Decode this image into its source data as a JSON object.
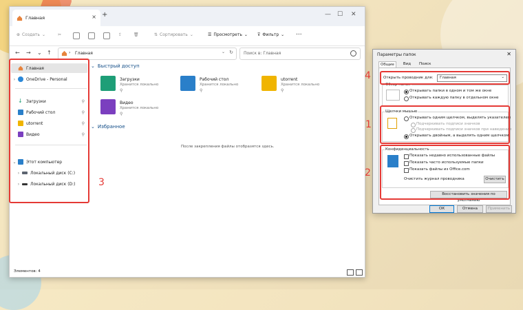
{
  "explorer": {
    "tab_title": "Главная",
    "toolbar": {
      "create": "Создать",
      "sort": "Сортировать",
      "view": "Просмотреть",
      "filter": "Фильтр",
      "more": "..."
    },
    "address": "Главная",
    "search_placeholder": "Поиск в: Главная",
    "nav": {
      "home": "Главная",
      "onedrive": "OneDrive - Personal",
      "downloads": "Загрузки",
      "desktop": "Рабочий стол",
      "utorrent": "utorrent",
      "video": "Видео",
      "this_pc": "Этот компьютер",
      "disk_c": "Локальный диск (C:)",
      "disk_d": "Локальный диск (D:)"
    },
    "quick_access_title": "Быстрый доступ",
    "quick_access": [
      {
        "name": "Загрузки",
        "sub": "Хранится локально"
      },
      {
        "name": "Рабочий стол",
        "sub": "Хранится локально"
      },
      {
        "name": "utorrent",
        "sub": "Хранится локально"
      },
      {
        "name": "Видео",
        "sub": "Хранится локально"
      }
    ],
    "favorites_title": "Избранное",
    "favorites_empty": "После закрепления файлы отобразятся здесь.",
    "status": "Элементов: 4"
  },
  "dialog": {
    "title": "Параметры папок",
    "tabs": [
      "Общие",
      "Вид",
      "Поиск"
    ],
    "open_explorer_label": "Открыть проводник для:",
    "open_explorer_value": "Главная",
    "browse_title": "Обзор папок",
    "browse_same": "Открывать папки в одном и том же окне",
    "browse_new": "Открывать каждую папку в отдельном окне",
    "click_title": "Щелчки мышью",
    "single_click": "Открывать одним щелчком, выделять указателем",
    "underline_always": "Подчеркивать подписи значков",
    "underline_hover": "Подчеркивать подписи значков при наведении",
    "double_click": "Открывать двойным, а выделять одним щелчком",
    "privacy_title": "Конфиденциальность",
    "show_recent": "Показать недавно использованные файлы",
    "show_frequent": "Показать часто используемые папки",
    "show_office": "Показать файлы из Office.com",
    "clear_history": "Очистить журнал проводника",
    "clear_btn": "Очистить",
    "restore_btn": "Восстановить значения по умолчанию",
    "ok": "ОК",
    "cancel": "Отмена",
    "apply": "Применить"
  },
  "markers": {
    "m1": "1",
    "m2": "2",
    "m3": "3",
    "m4": "4"
  },
  "colors": {
    "highlight": "#e53935",
    "folder": "#f0b400",
    "download": "#1e9e77",
    "desktop": "#2a7fc9",
    "video": "#7b3fbf"
  }
}
